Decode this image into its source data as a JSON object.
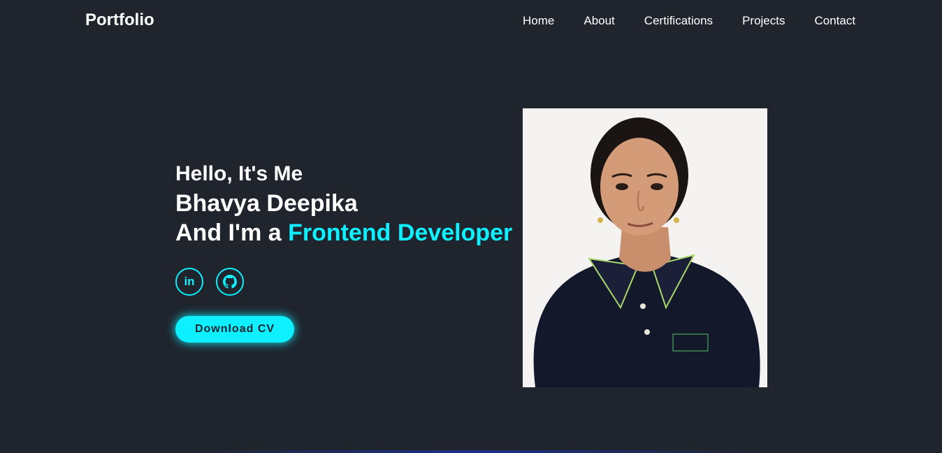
{
  "header": {
    "logo": "Portfolio",
    "nav": [
      "Home",
      "About",
      "Certifications",
      "Projects",
      "Contact"
    ]
  },
  "hero": {
    "greeting": "Hello, It's Me",
    "name": "Bhavya Deepika",
    "role_prefix": "And I'm a ",
    "role": "Frontend Developer"
  },
  "socials": [
    {
      "icon": "linkedin-icon",
      "label": "in"
    },
    {
      "icon": "github-icon"
    }
  ],
  "cta": {
    "download_label": "Download CV"
  },
  "colors": {
    "background": "#1f242d",
    "accent": "#0ef0ff",
    "text": "#ffffff"
  }
}
